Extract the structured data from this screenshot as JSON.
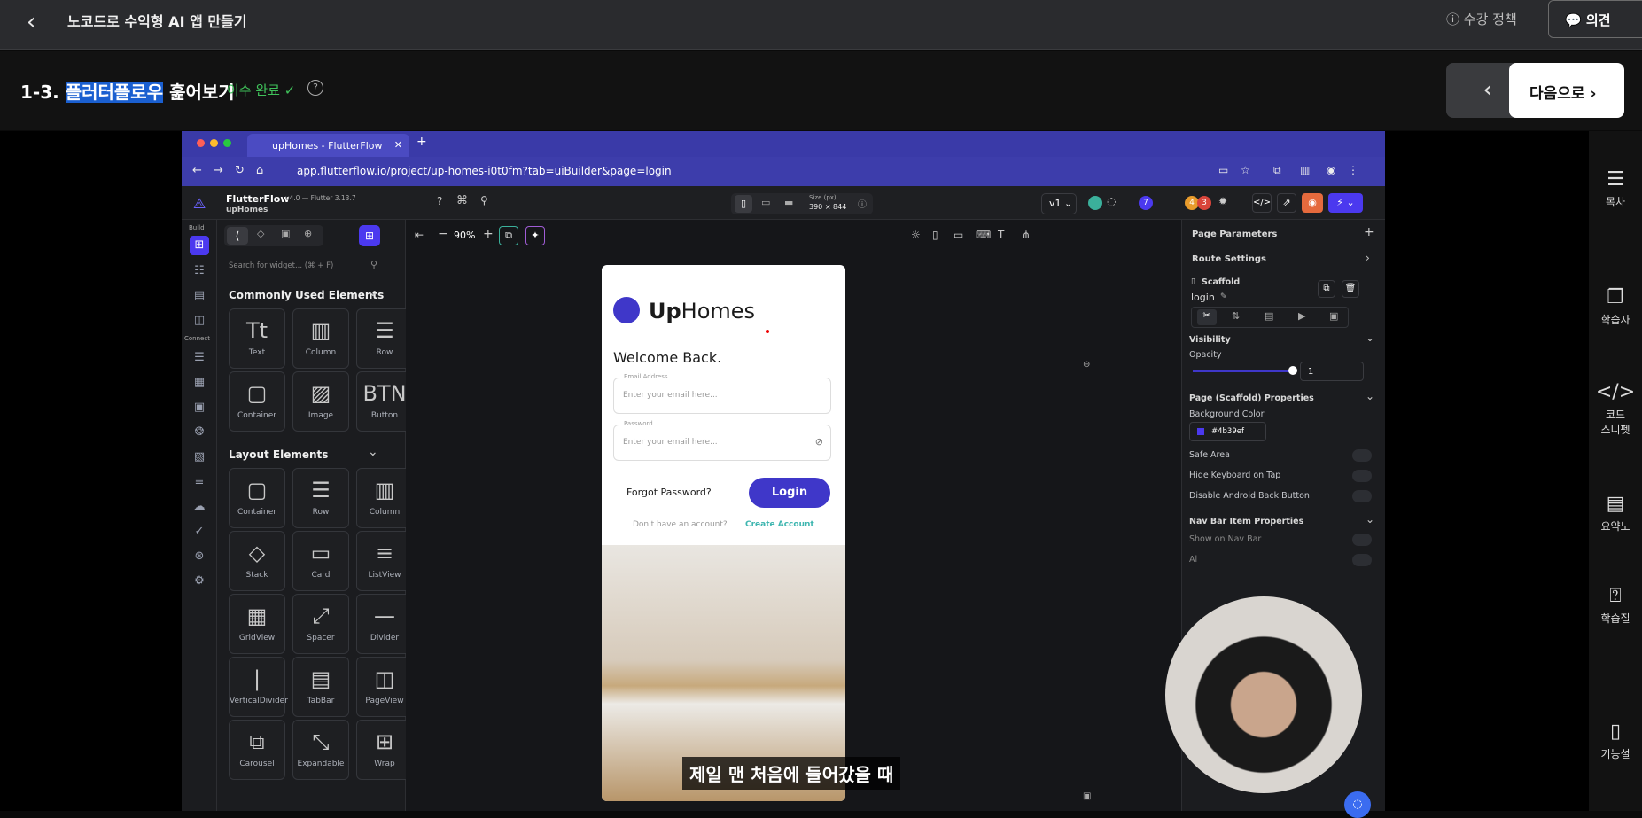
{
  "topbar": {
    "back_icon": "chevron-left-icon",
    "course_title": "노코드로 수익형 AI 앱 만들기",
    "policy_label": "수강 정책",
    "opinion_label": "의견"
  },
  "lesson": {
    "number": "1-3.",
    "title_highlight": "플러터플로우",
    "title_rest": "훑어보기",
    "status": "이수 완료 ✓",
    "next_label": "다음으로"
  },
  "rside": {
    "items": [
      {
        "label": "목차",
        "icon": "list-icon"
      },
      {
        "label": "학습자",
        "icon": "copy-icon"
      },
      {
        "label": "코드\n스니펫",
        "icon": "code-icon"
      },
      {
        "label": "요약노",
        "icon": "note-icon"
      },
      {
        "label": "학습질",
        "icon": "question-icon"
      },
      {
        "label": "기능설",
        "icon": "book-icon"
      }
    ]
  },
  "browser": {
    "tab_title": "upHomes - FlutterFlow",
    "url": "app.flutterflow.io/project/up-homes-i0t0fm?tab=uiBuilder&page=login"
  },
  "ff": {
    "app_name": "FlutterFlow",
    "version": "v4.0 — Flutter 3.13.7",
    "project": "upHomes",
    "rail_build": "Build",
    "rail_connect": "Connect",
    "size_label": "Size (px)",
    "size_value": "390 × 844",
    "version_select": "v1",
    "badge_7": "7",
    "badge_4": "4",
    "badge_3": "3",
    "zoom": "90%",
    "search_placeholder": "Search for widget... (⌘ + F)",
    "common_title": "Commonly Used Elements",
    "common": [
      "Text",
      "Column",
      "Row",
      "Container",
      "Image",
      "Button"
    ],
    "layout_title": "Layout Elements",
    "layout": [
      "Container",
      "Row",
      "Column",
      "Stack",
      "Card",
      "ListView",
      "GridView",
      "Spacer",
      "Divider",
      "VerticalDivider",
      "TabBar",
      "PageView",
      "Carousel",
      "Expandable",
      "Wrap"
    ]
  },
  "phone": {
    "logo": "UpHomes",
    "logo_bold": "Up",
    "logo_light": "Homes",
    "welcome": "Welcome Back.",
    "email_label": "Email Address",
    "email_placeholder": "Enter your email here...",
    "password_label": "Password",
    "password_placeholder": "Enter your email here...",
    "forgot": "Forgot Password?",
    "login": "Login",
    "no_account": "Don't have an account?",
    "create": "Create Account",
    "accent": "#4b39ef"
  },
  "rpanel": {
    "page_params": "Page Parameters",
    "route_settings": "Route Settings",
    "widget_type": "Scaffold",
    "widget_name": "login",
    "visibility": "Visibility",
    "opacity_label": "Opacity",
    "opacity_value": "1",
    "props_title": "Page (Scaffold) Properties",
    "bg_color_label": "Background Color",
    "bg_color": "#4b39ef",
    "safe_area": "Safe Area",
    "hide_keyboard": "Hide Keyboard on Tap",
    "disable_back": "Disable Android Back Button",
    "navbar_title": "Nav Bar Item Properties",
    "show_on_nav": "Show on Nav Bar",
    "always": "Al"
  },
  "subtitle": "제일 맨 처음에 들어갔을 때"
}
